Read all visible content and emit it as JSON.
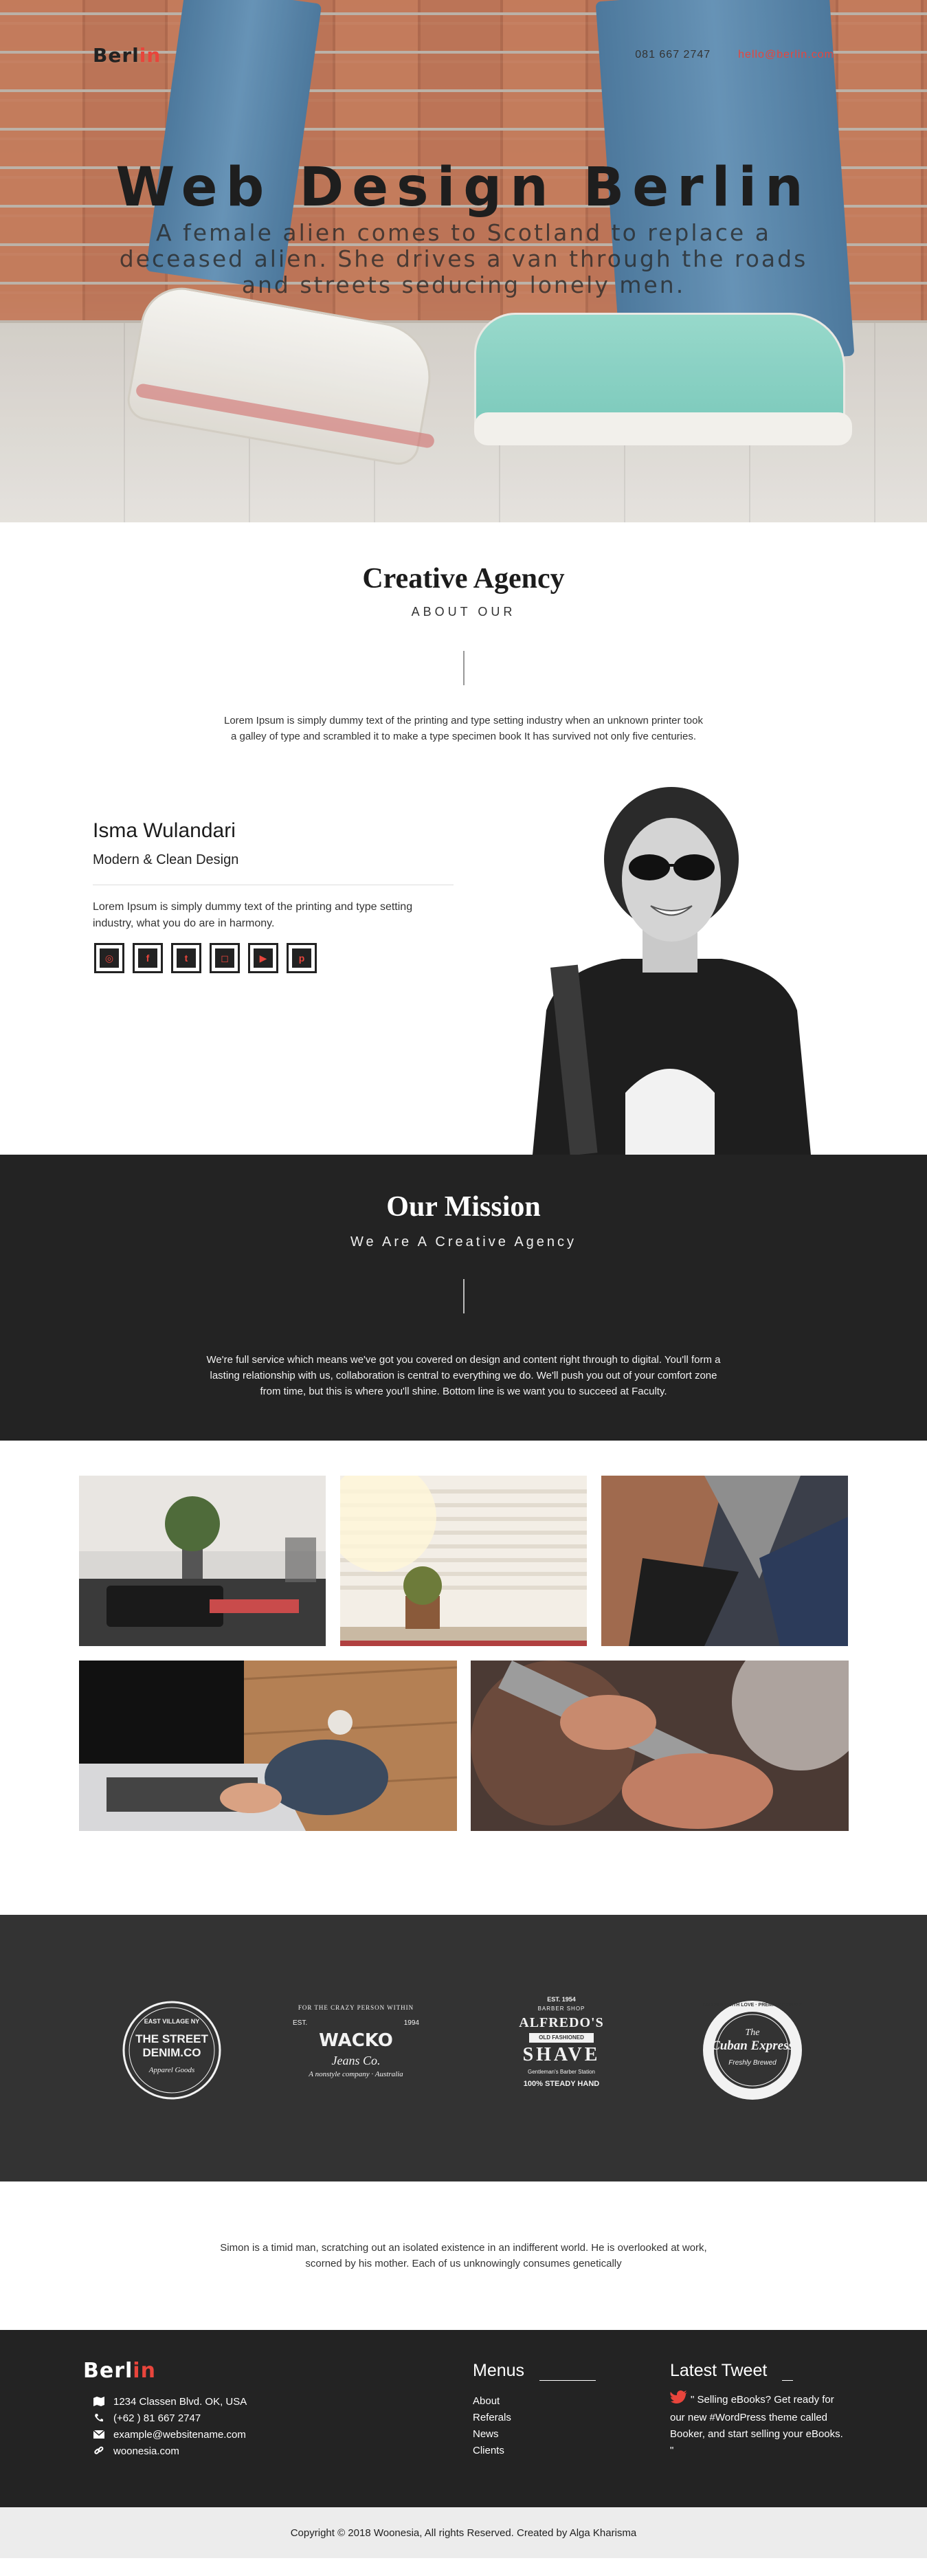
{
  "header": {
    "logo_part1": "Berl",
    "logo_part2": "in",
    "phone": "081 667 2747",
    "email": "hello@berlin.com"
  },
  "hero": {
    "title": "Web Design Berlin",
    "subtitle": "A female alien comes to Scotland to replace a deceased alien. She drives a van through the roads and streets seducing lonely men."
  },
  "about": {
    "title": "Creative Agency",
    "label": "ABOUT OUR",
    "text": "Lorem Ipsum is simply dummy text of the printing and type setting industry when an unknown printer took a galley of type and scrambled it to make a type specimen book It has survived not only five centuries."
  },
  "profile": {
    "name": "Isma Wulandari",
    "role": "Modern & Clean Design",
    "text": "Lorem Ipsum is simply dummy text of the printing and type setting industry, what you do are in harmony.",
    "socials": [
      {
        "icon": "dribbble-icon",
        "glyph": "◎"
      },
      {
        "icon": "facebook-icon",
        "glyph": "f"
      },
      {
        "icon": "twitter-icon",
        "glyph": "t"
      },
      {
        "icon": "instagram-icon",
        "glyph": "◻"
      },
      {
        "icon": "youtube-icon",
        "glyph": "▶"
      },
      {
        "icon": "pinterest-icon",
        "glyph": "p"
      }
    ]
  },
  "mission": {
    "title": "Our Mission",
    "label": "We Are A Creative Agency",
    "text": "We're full service which means we've got you covered on design and content right through to digital. You'll form a lasting relationship with us, collaboration is central to everything we do. We'll push you out of your comfort zone from time, but this is where you'll shine. Bottom line is we want you to succeed at Faculty."
  },
  "brands": {
    "b1": {
      "top": "EAST VILLAGE NY",
      "mid1": "THE STREET",
      "mid2": "DENIM.CO",
      "bottom": "Apparel Goods"
    },
    "b2": {
      "top": "FOR THE CRAZY PERSON WITHIN",
      "est": "EST.",
      "year": "1994",
      "name": "WACKO",
      "script": "Jeans Co.",
      "bottom": "A nonstyle company · Australia"
    },
    "b3": {
      "top": "EST. 1954",
      "sub": "BARBER SHOP",
      "name1": "ALFREDO'S",
      "band": "OLD FASHIONED",
      "name2": "SHAVE",
      "tag": "Gentleman's Barber Station",
      "bottom": "100% STEADY HAND"
    },
    "b4": {
      "ring": "CRAFTED WITH LOVE · PREMIUM COFFEE",
      "name1": "The",
      "name2": "Cuban Express",
      "bottom": "Freshly Brewed"
    }
  },
  "quote": {
    "text": "Simon is a timid man, scratching out an isolated existence in an indifferent world. He is overlooked at work, scorned by his mother. Each of us unknowingly consumes genetically"
  },
  "footer": {
    "logo_part1": "Berl",
    "logo_part2": "in",
    "address": "1234 Classen Blvd. OK, USA",
    "phone": "(+62 ) 81 667 2747",
    "email": "example@websitename.com",
    "website": "woonesia.com",
    "menus_title": "Menus",
    "menu_items": [
      "About",
      "Referals",
      "News",
      "Clients"
    ],
    "tweet_title": "Latest Tweet",
    "tweet_text": "\" Selling eBooks? Get ready for our new #WordPress theme called Booker, and start selling your eBooks. \"",
    "copyright": "Copyright © 2018 Woonesia, All rights Reserved. Created by Alga Kharisma"
  },
  "colors": {
    "accent": "#e8453c",
    "dark": "#232323",
    "brand_bg": "#333333",
    "copyright_bg": "#ececec"
  }
}
